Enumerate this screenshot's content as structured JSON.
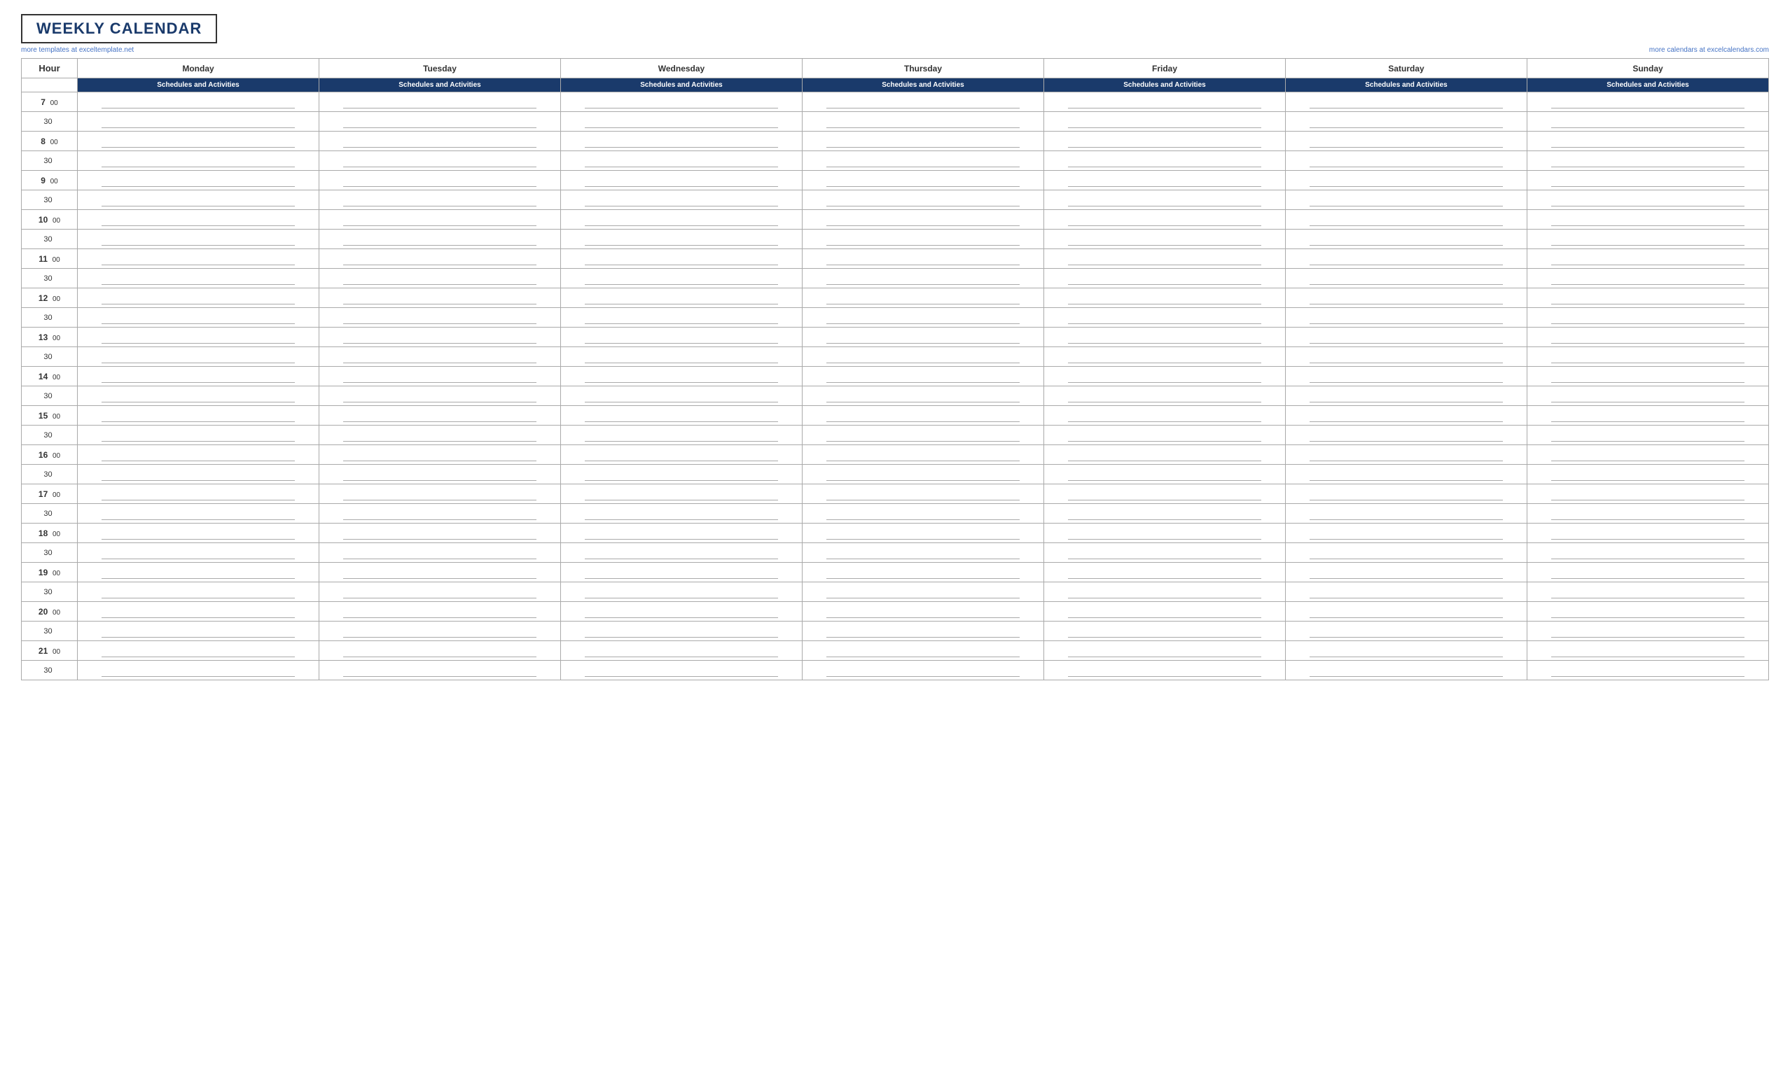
{
  "header": {
    "title": "WEEKLY CALENDAR",
    "link_left": "more templates at exceltemplate.net",
    "link_right": "more calendars at excelcalendars.com"
  },
  "columns": {
    "hour_label": "Hour",
    "days": [
      "Monday",
      "Tuesday",
      "Wednesday",
      "Thursday",
      "Friday",
      "Saturday",
      "Sunday"
    ],
    "sub_label": "Schedules and Activities"
  },
  "time_slots": [
    {
      "hour": "7",
      "min": "00",
      "type": "main"
    },
    {
      "hour": "",
      "min": "30",
      "type": "half"
    },
    {
      "hour": "8",
      "min": "00",
      "type": "main"
    },
    {
      "hour": "",
      "min": "30",
      "type": "half"
    },
    {
      "hour": "9",
      "min": "00",
      "type": "main"
    },
    {
      "hour": "",
      "min": "30",
      "type": "half"
    },
    {
      "hour": "10",
      "min": "00",
      "type": "main"
    },
    {
      "hour": "",
      "min": "30",
      "type": "half"
    },
    {
      "hour": "11",
      "min": "00",
      "type": "main"
    },
    {
      "hour": "",
      "min": "30",
      "type": "half"
    },
    {
      "hour": "12",
      "min": "00",
      "type": "main"
    },
    {
      "hour": "",
      "min": "30",
      "type": "half"
    },
    {
      "hour": "13",
      "min": "00",
      "type": "main"
    },
    {
      "hour": "",
      "min": "30",
      "type": "half"
    },
    {
      "hour": "14",
      "min": "00",
      "type": "main"
    },
    {
      "hour": "",
      "min": "30",
      "type": "half"
    },
    {
      "hour": "15",
      "min": "00",
      "type": "main"
    },
    {
      "hour": "",
      "min": "30",
      "type": "half"
    },
    {
      "hour": "16",
      "min": "00",
      "type": "main"
    },
    {
      "hour": "",
      "min": "30",
      "type": "half"
    },
    {
      "hour": "17",
      "min": "00",
      "type": "main"
    },
    {
      "hour": "",
      "min": "30",
      "type": "half"
    },
    {
      "hour": "18",
      "min": "00",
      "type": "main"
    },
    {
      "hour": "",
      "min": "30",
      "type": "half"
    },
    {
      "hour": "19",
      "min": "00",
      "type": "main"
    },
    {
      "hour": "",
      "min": "30",
      "type": "half"
    },
    {
      "hour": "20",
      "min": "00",
      "type": "main"
    },
    {
      "hour": "",
      "min": "30",
      "type": "half"
    },
    {
      "hour": "21",
      "min": "00",
      "type": "main"
    },
    {
      "hour": "",
      "min": "30",
      "type": "half"
    }
  ]
}
